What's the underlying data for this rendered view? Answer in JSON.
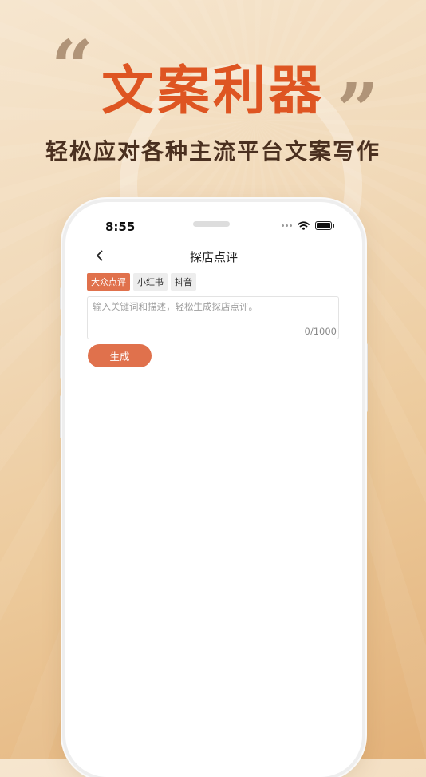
{
  "banner": {
    "headline": "文案利器",
    "quote_open": "“",
    "quote_close": "”",
    "subtitle": "轻松应对各种主流平台文案写作"
  },
  "status_bar": {
    "time": "8:55",
    "icons": [
      "signal-dots-icon",
      "wifi-icon",
      "battery-icon"
    ]
  },
  "nav": {
    "back_icon": "chevron-left-icon",
    "title": "探店点评"
  },
  "tabs": [
    {
      "label": "大众点评",
      "active": true
    },
    {
      "label": "小红书",
      "active": false
    },
    {
      "label": "抖音",
      "active": false
    }
  ],
  "input": {
    "placeholder": "输入关键词和描述，轻松生成探店点评。",
    "value": "",
    "counter": "0/1000"
  },
  "generate_button": {
    "label": "生成"
  },
  "colors": {
    "accent": "#e0714c",
    "headline": "#de5522",
    "subtitle": "#4a3020"
  }
}
